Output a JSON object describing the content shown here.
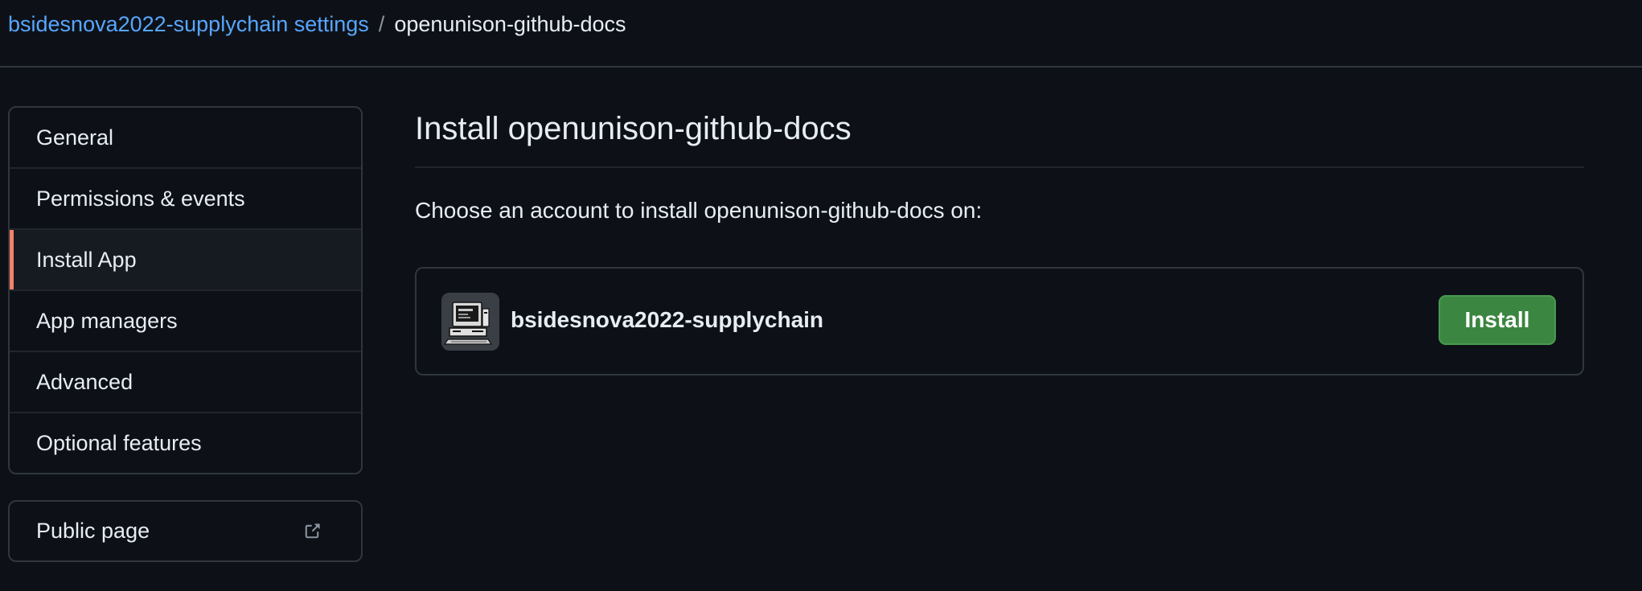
{
  "breadcrumb": {
    "parent": "bsidesnova2022-supplychain settings",
    "separator": "/",
    "current": "openunison-github-docs"
  },
  "sidebar": {
    "items": [
      {
        "label": "General",
        "active": false
      },
      {
        "label": "Permissions & events",
        "active": false
      },
      {
        "label": "Install App",
        "active": true
      },
      {
        "label": "App managers",
        "active": false
      },
      {
        "label": "Advanced",
        "active": false
      },
      {
        "label": "Optional features",
        "active": false
      }
    ],
    "public_page": {
      "label": "Public page",
      "icon": "external-link-icon"
    }
  },
  "main": {
    "title": "Install openunison-github-docs",
    "subtitle": "Choose an account to install openunison-github-docs on:",
    "account": {
      "name": "bsidesnova2022-supplychain",
      "avatar_icon": "retro-computer-avatar",
      "install_label": "Install"
    }
  },
  "colors": {
    "background": "#0d1117",
    "link": "#58a6ff",
    "active_indicator": "#f78166",
    "install_button": "#3b8640"
  }
}
